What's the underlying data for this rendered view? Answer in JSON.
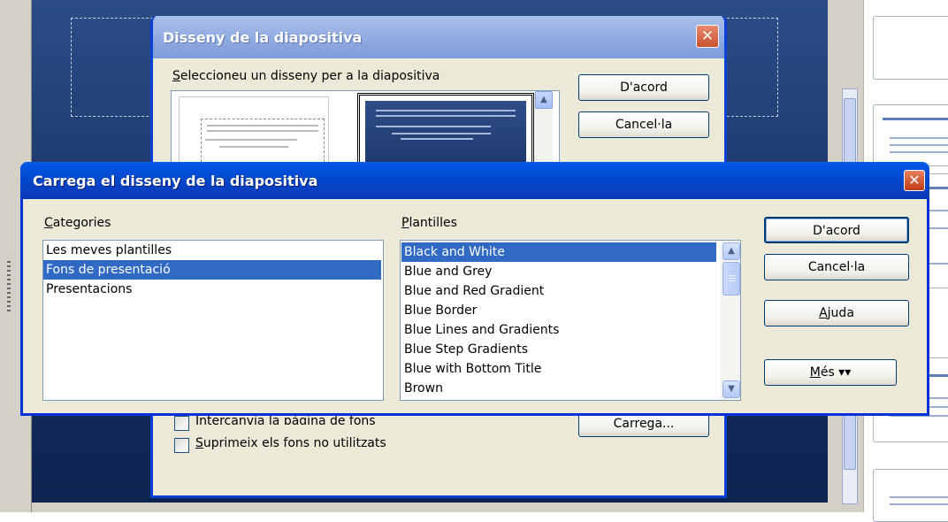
{
  "back_dialog": {
    "title": "Disseny de la diapositiva",
    "close_glyph": "✕",
    "prompt": "Seleccioneu un disseny per a la diapositiva",
    "ok_label": "D'acord",
    "cancel_label": "Cancel·la",
    "load_label": "Carrega...",
    "swap_bg_label": "Intercanvia la pàgina de fons",
    "delete_unused_label": "Suprimeix els fons no utilitzats",
    "swap_bg_checked": false,
    "delete_unused_checked": false
  },
  "front_dialog": {
    "title": "Carrega el disseny de la diapositiva",
    "close_glyph": "✕",
    "categories_label": "Categories",
    "templates_label": "Plantilles",
    "categories": [
      "Les meves plantilles",
      "Fons de presentació",
      "Presentacions"
    ],
    "selected_category": "Fons de presentació",
    "templates": [
      "Black and White",
      "Blue and Grey",
      "Blue and Red Gradient",
      "Blue Border",
      "Blue Lines and Gradients",
      "Blue Step Gradients",
      "Blue with Bottom Title",
      "Brown"
    ],
    "selected_template": "Black and White",
    "ok_label": "D'acord",
    "cancel_label": "Cancel·la",
    "help_label": "Ajuda",
    "more_label": "Més ▾▾"
  },
  "colors": {
    "title_bar_active": "#0a3ebe",
    "title_bar_inactive": "#8ea9e0",
    "selection": "#316ac5",
    "dialog_face": "#ece9d8",
    "close_button": "#c23b14",
    "slide_background": "#173366"
  },
  "icons": {
    "scroll_up": "chevron-up-icon",
    "scroll_down": "chevron-down-icon",
    "more": "double-chevron-down-icon",
    "close": "close-icon"
  }
}
